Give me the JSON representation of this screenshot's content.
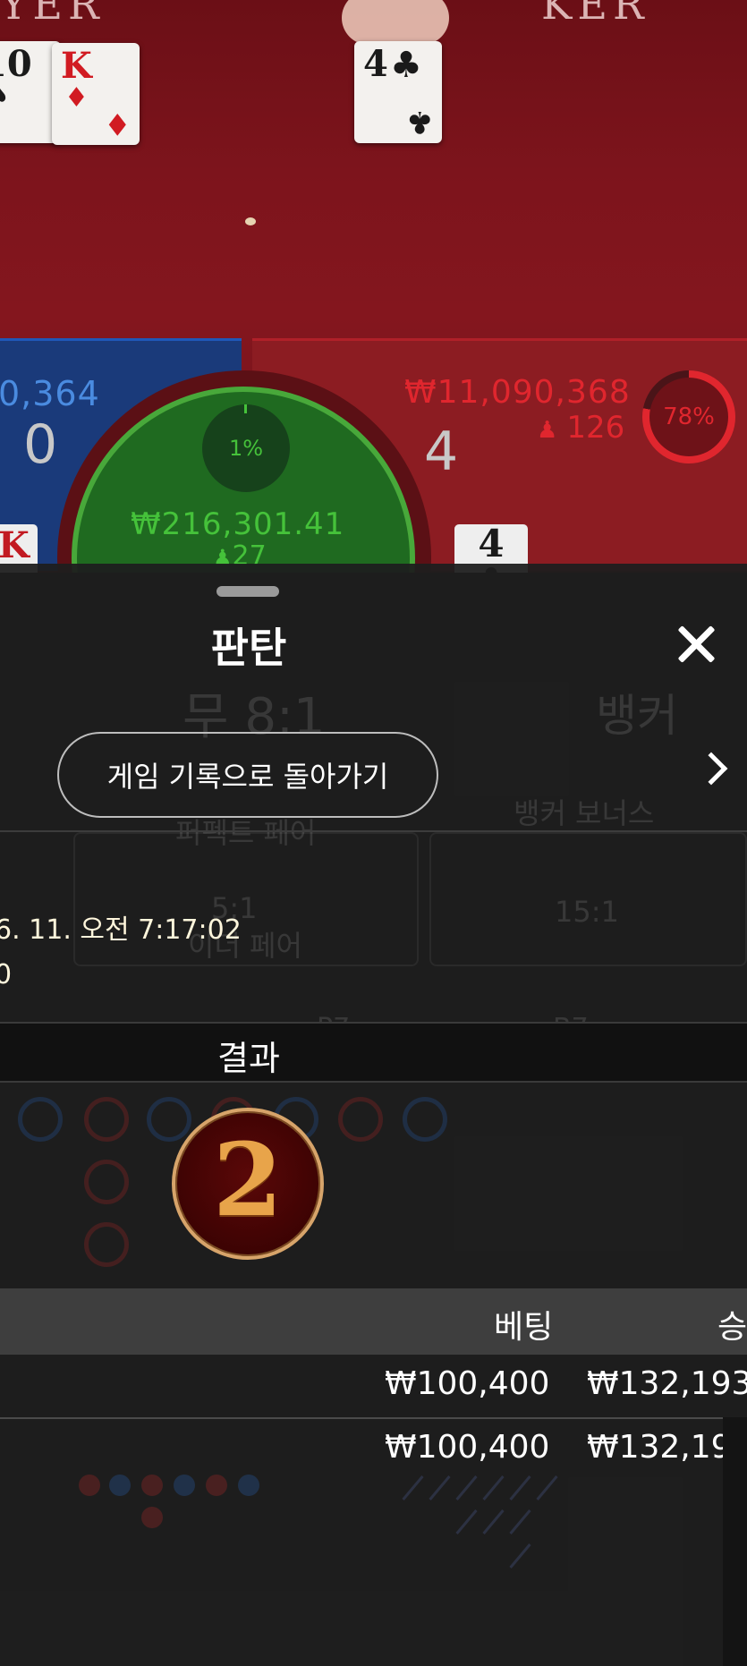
{
  "table": {
    "top_label_left": "YER",
    "top_label_right": "KER",
    "player": {
      "amount": "0,364",
      "score": "0"
    },
    "tie": {
      "percent": "1%",
      "amount": "₩216,301.41",
      "players": "27",
      "percent_value": 0.01
    },
    "banker": {
      "amount": "₩11,090,368",
      "players": "126",
      "score": "4",
      "percent": "78%",
      "percent_value": 0.78
    },
    "cards": {
      "player_card_1": {
        "rank": "10",
        "suit": "♠"
      },
      "player_card_2": {
        "rank": "K",
        "suit": "♦"
      },
      "banker_card_1": {
        "rank": "4",
        "suit": "♣"
      },
      "player_mini": {
        "rank": "K"
      },
      "banker_mini": {
        "rank": "4",
        "suit": "♣"
      }
    }
  },
  "sheet": {
    "title": "판탄",
    "back_button": "게임 기록으로 돌아가기",
    "info": {
      "datetime": "6. 11. 오전 7:17:02",
      "round": "0"
    },
    "result_label": "결과",
    "result_value": "2",
    "columns": {
      "bet": "베팅",
      "win": "승"
    },
    "rows": [
      {
        "bet": "₩100,400",
        "win": "₩132,193"
      },
      {
        "bet": "₩100,400",
        "win": "₩132,193"
      }
    ]
  },
  "background_ghost": {
    "tie_odds": "무 8:1",
    "banker": "뱅커",
    "perfect_pair": "퍼펙트 페어",
    "banker_bonus": "뱅커 보너스",
    "either_pair_odds": "5:1",
    "either_pair": "이더 페어",
    "bonus_odds": "15:1",
    "stat_p": "P7",
    "stat_b": "B7"
  },
  "colors": {
    "banker_red": "#e0262e",
    "player_blue": "#4a8be0",
    "tie_green": "#45c23a",
    "badge_gold": "#e8a44a"
  }
}
